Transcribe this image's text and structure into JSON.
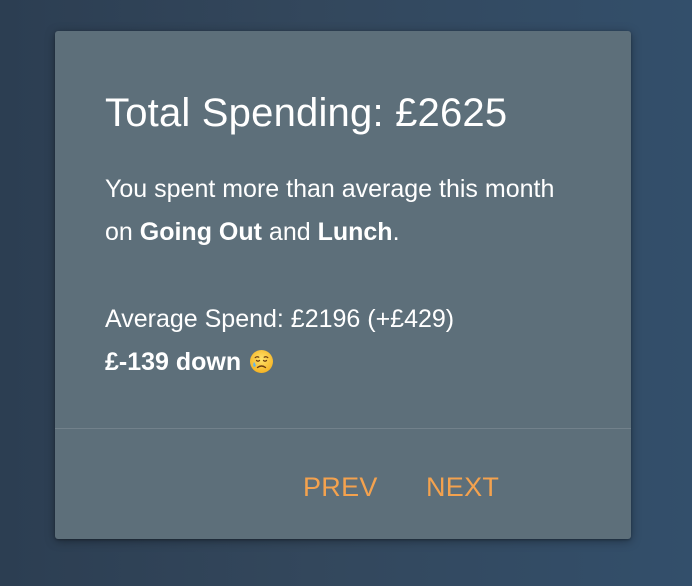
{
  "card": {
    "title": "Total Spending: £2625",
    "summary": {
      "prefix": "You spent more than average this month on ",
      "category_1": "Going Out",
      "conjunction": " and ",
      "category_2": "Lunch",
      "suffix": "."
    },
    "average_line": "Average Spend: £2196 (+£429)",
    "delta_line": "£-139 down",
    "delta_emoji": "sad-but-relieved-face-icon"
  },
  "actions": {
    "prev_label": "PREV",
    "next_label": "NEXT"
  },
  "colors": {
    "card_background": "#5d6f7a",
    "accent": "#f4a24e",
    "text": "#ffffff"
  }
}
